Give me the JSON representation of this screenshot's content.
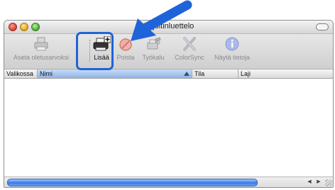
{
  "window": {
    "title": "Kirjoitinluettelo"
  },
  "toolbar": {
    "items": [
      {
        "label": "Aseta oletusarvoksi",
        "icon": "printer-default-icon"
      },
      {
        "label": "Lisää",
        "icon": "add-printer-icon"
      },
      {
        "label": "Poista",
        "icon": "delete-printer-icon"
      },
      {
        "label": "Työkalu",
        "icon": "utility-tools-icon"
      },
      {
        "label": "ColorSync",
        "icon": "colorsync-icon"
      },
      {
        "label": "Näytä tietoja",
        "icon": "info-icon"
      }
    ]
  },
  "table": {
    "columns": [
      "Valikossa",
      "Nimi",
      "Tila",
      "Laji"
    ],
    "sorted_column": "Nimi",
    "rows": []
  },
  "annotation": {
    "color": "#1e63d9",
    "target": "Lisää"
  }
}
